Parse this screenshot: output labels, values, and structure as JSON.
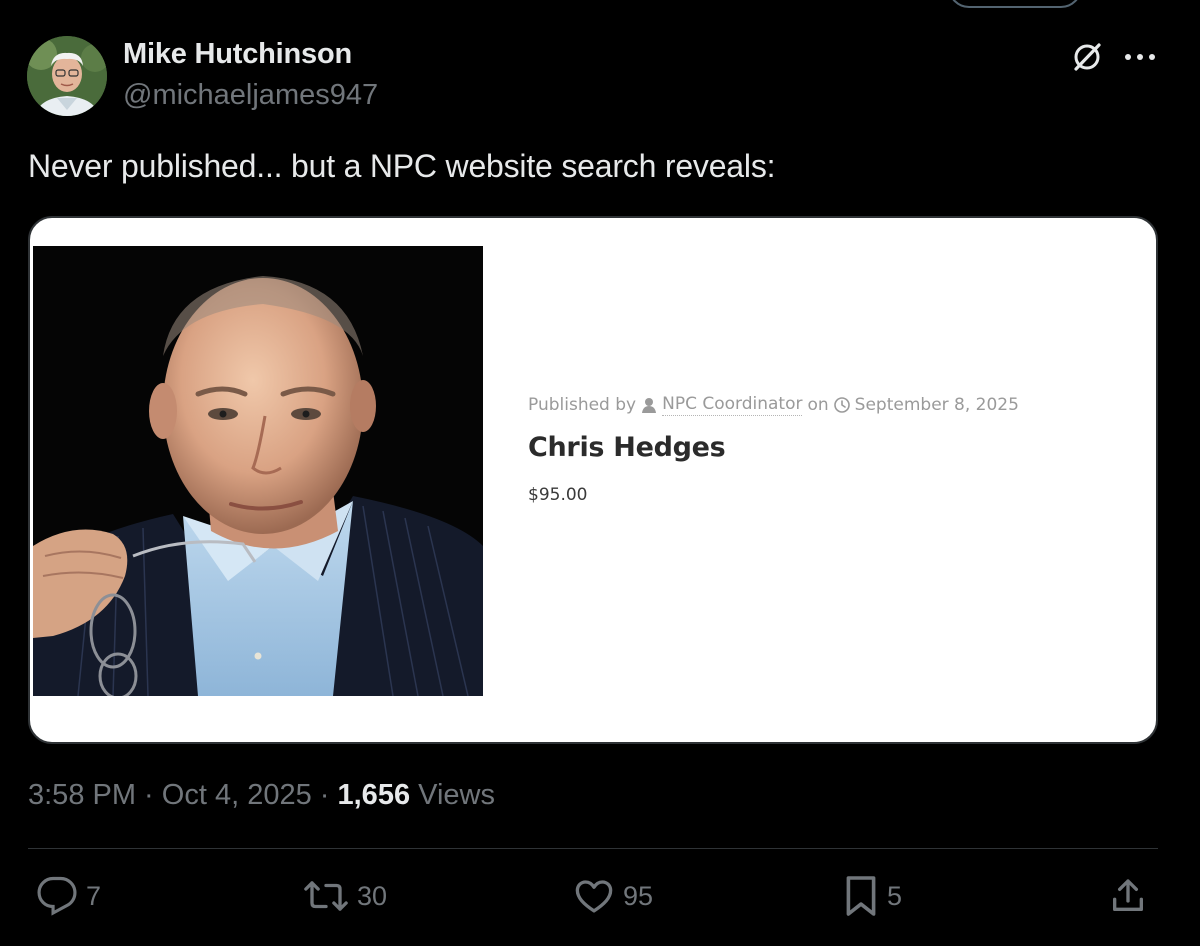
{
  "author": {
    "name": "Mike Hutchinson",
    "handle": "@michaeljames947"
  },
  "header_icons": [
    "grok-icon",
    "more-icon"
  ],
  "tweet": {
    "text": "Never published... but a NPC website search reveals:"
  },
  "card": {
    "meta_prefix": "Published by",
    "meta_author": "NPC Coordinator",
    "meta_on": "on",
    "meta_date": "September 8, 2025",
    "title": "Chris Hedges",
    "price": "$95.00"
  },
  "timestamp": {
    "time": "3:58 PM",
    "sep1": " · ",
    "date": "Oct 4, 2025",
    "sep2": " · ",
    "views_count": "1,656",
    "views_label": " Views"
  },
  "actions": {
    "replies": "7",
    "reposts": "30",
    "likes": "95",
    "bookmarks": "5"
  },
  "colors": {
    "background": "#000000",
    "text_primary": "#e7e9ea",
    "text_secondary": "#71767b",
    "divider": "#2f3336",
    "card_background": "#ffffff"
  }
}
